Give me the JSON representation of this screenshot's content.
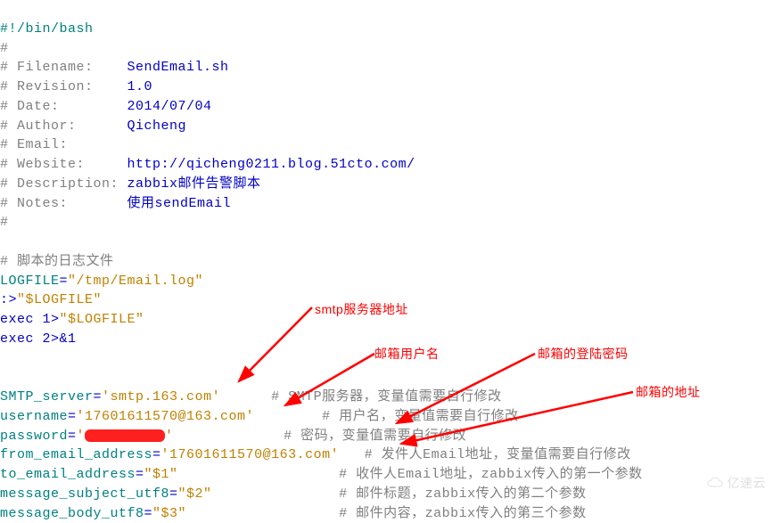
{
  "header": {
    "shebang": "#!/bin/bash",
    "filename_label": "# Filename:    ",
    "filename_value": "SendEmail.sh",
    "revision_label": "# Revision:    ",
    "revision_value": "1.0",
    "date_label": "# Date:        ",
    "date_value": "2014/07/04",
    "author_label": "# Author:      ",
    "author_value": "Qicheng",
    "email_label": "# Email:",
    "website_label": "# Website:     ",
    "website_value": "http://qicheng0211.blog.51cto.com/",
    "description_label": "# Description: ",
    "description_value": "zabbix邮件告警脚本",
    "notes_label": "# Notes:       ",
    "notes_value": "使用sendEmail",
    "hash": "#"
  },
  "section_comment": "# 脚本的日志文件",
  "logfile": {
    "var": "LOGFILE",
    "eq": "=",
    "val": "\"/tmp/Email.log\"",
    "redir1a": ":>",
    "redir1b": "\"$LOGFILE\"",
    "exec1a": "exec ",
    "exec1b": "1>",
    "exec1c": "\"$LOGFILE\"",
    "exec2a": "exec ",
    "exec2b": "2>&1"
  },
  "vars": {
    "smtp_server_var": "SMTP_server",
    "smtp_server_val": "'smtp.163.com'",
    "smtp_server_cmt": "# SMTP服务器，变量值需要自行修改",
    "username_var": "username",
    "username_val": "'17601611570@163.com'",
    "username_cmt": "# 用户名，变量值需要自行修改",
    "password_var": "password",
    "password_val_prefix": "'",
    "password_val_suffix": "'",
    "password_cmt": "# 密码，变量值需要自行修改",
    "from_var": "from_email_address",
    "from_val": "'17601611570@163.com'",
    "from_cmt": "# 发件人Email地址，变量值需要自行修改",
    "to_var": "to_email_address",
    "to_val": "\"$1\"",
    "to_cmt": "# 收件人Email地址，zabbix传入的第一个参数",
    "subj_var": "message_subject_utf8",
    "subj_val": "\"$2\"",
    "subj_cmt": "# 邮件标题，zabbix传入的第二个参数",
    "body_var": "message_body_utf8",
    "body_val": "\"$3\"",
    "body_cmt": "# 邮件内容，zabbix传入的第三个参数"
  },
  "annotations": {
    "smtp": "smtp服务器地址",
    "user": "邮箱用户名",
    "pass": "邮箱的登陆密码",
    "addr": "邮箱的地址"
  },
  "watermark": "亿速云"
}
